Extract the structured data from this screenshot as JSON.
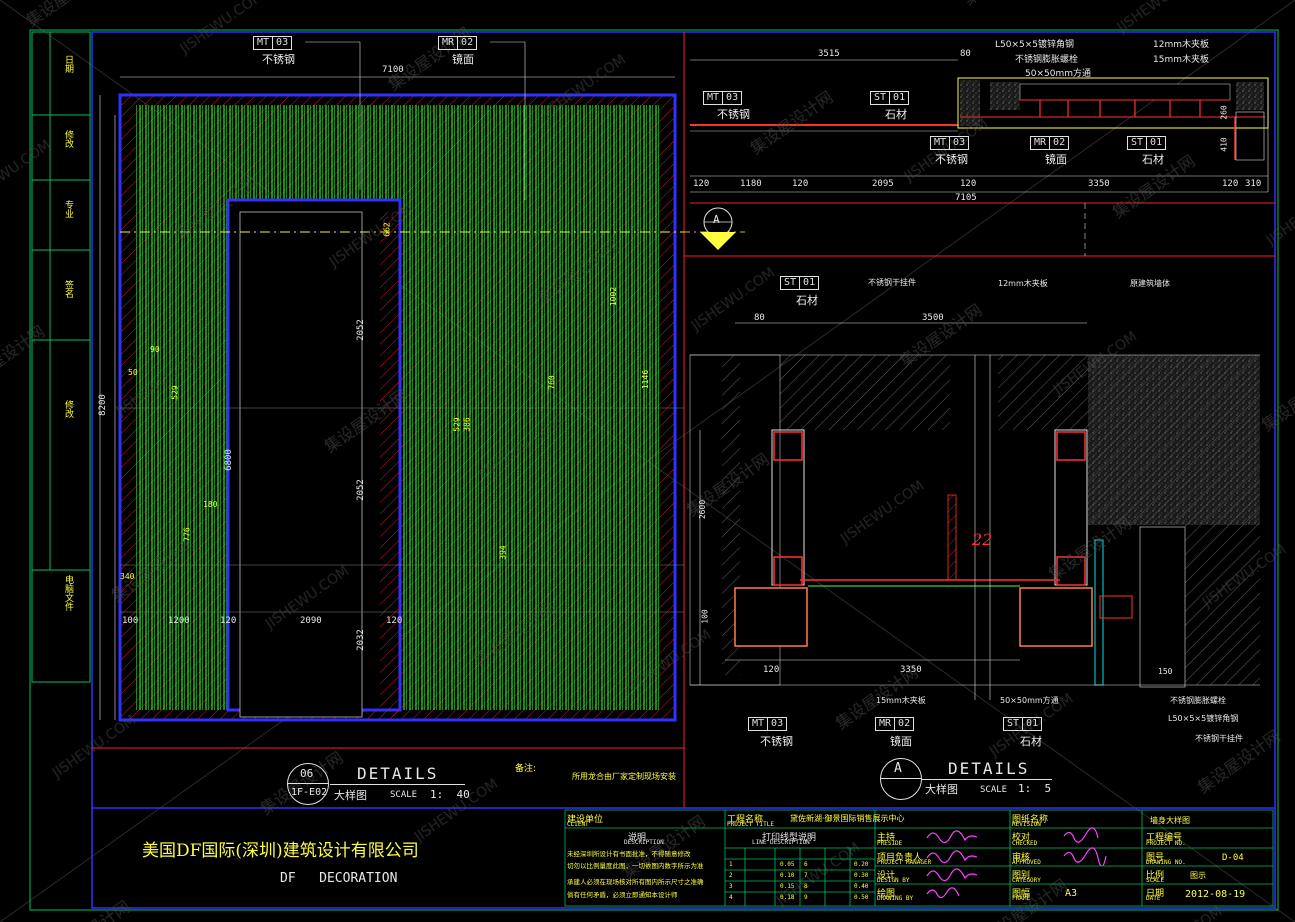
{
  "watermark": {
    "cn": "集设屋设计网",
    "en": "JISHEWU.COM"
  },
  "left_sidebar": [
    "日期",
    "修改",
    "专业",
    "签名",
    "修改",
    "电脑文件"
  ],
  "elevation": {
    "tags": [
      {
        "code": "MT",
        "num": "03",
        "name": "不锈钢"
      },
      {
        "code": "MR",
        "num": "02",
        "name": "镜面"
      }
    ],
    "dims": {
      "top_total": "7100",
      "left_total": "8200",
      "left_inner": "6800",
      "bottom": [
        "100",
        "1200",
        "120",
        "2090",
        "120"
      ],
      "center_stack": [
        "2052",
        "2052",
        "2032"
      ],
      "misc": [
        "662",
        "529",
        "529",
        "776",
        "180",
        "340",
        "386",
        "394",
        "760",
        "1002",
        "1146",
        "50",
        "90"
      ]
    },
    "title_num": "06",
    "title_ref": "1F-E02",
    "title_cn": "大样图",
    "title_en": "DETAILS",
    "scale_label": "SCALE",
    "scale_value": "1:  40"
  },
  "plan": {
    "tags": [
      {
        "code": "MT",
        "num": "03",
        "name": "不锈钢"
      },
      {
        "code": "ST",
        "num": "01",
        "name": "石材"
      },
      {
        "code": "MT",
        "num": "03",
        "name": "不锈钢"
      },
      {
        "code": "MR",
        "num": "02",
        "name": "镜面"
      },
      {
        "code": "ST",
        "num": "01",
        "name": "石材"
      }
    ],
    "notes": [
      "L50×5×5镀锌角钢",
      "不锈钢膨胀螺栓",
      "50×50mm方通",
      "12mm木夹板",
      "15mm木夹板"
    ],
    "dims_top": [
      "3515",
      "80"
    ],
    "dims_bottom": [
      "120",
      "1180",
      "120",
      "2095",
      "120",
      "3350",
      "120",
      "310"
    ],
    "dims_total": "7105",
    "dims_right": [
      "260",
      "410"
    ],
    "section_marker": "A"
  },
  "section": {
    "tags": [
      {
        "code": "ST",
        "num": "01",
        "name": "石材"
      },
      {
        "code": "MT",
        "num": "03",
        "name": "不锈钢"
      },
      {
        "code": "MR",
        "num": "02",
        "name": "镜面"
      },
      {
        "code": "ST",
        "num": "01",
        "name": "石材"
      }
    ],
    "notes": [
      "不锈钢干挂件",
      "12mm木夹板",
      "原建筑墙体",
      "15mm木夹板",
      "50×50mm方通",
      "不锈钢膨胀螺栓",
      "L50×5×5镀锌角钢",
      "不锈钢干挂件"
    ],
    "dims": [
      "80",
      "3500",
      "2600",
      "100",
      "120",
      "3350",
      "150"
    ],
    "title_num": "A",
    "title_cn": "大样图",
    "title_en": "DETAILS",
    "scale_label": "SCALE",
    "scale_value": "1:  5"
  },
  "remark": {
    "label": "备注:",
    "text": "所用龙合由厂家定制现场安装"
  },
  "company": {
    "cn": "美国DF国际(深圳)建筑设计有限公司",
    "en": "DF   DECORATION"
  },
  "title_block": {
    "client_cn": "建设单位",
    "client_en": "CLIENT",
    "desc_cn": "说明",
    "desc_en": "DESCRIPTION",
    "desc_lines": [
      "未经深圳所设计有书面批准，不得随意修改",
      "切勿以比例量度此图，一切依图内数字所示为准",
      "承建人必须在现场核对所有图内所示尺寸之准确",
      "倘有任何矛盾，必须立即通知本设计师"
    ],
    "project_cn": "工程名称",
    "project_en": "PROJECT TITLE",
    "project_name": "黛佐新湖·御景国际销售展示中心",
    "lineweight_cn": "打印线型说明",
    "lineweight_en": "LINE DESCRIPTION",
    "lw_rows": [
      [
        "1",
        "0.05",
        "6",
        "0.20"
      ],
      [
        "2",
        "0.10",
        "7",
        "0.30"
      ],
      [
        "3",
        "0.15",
        "8",
        "0.40"
      ],
      [
        "4",
        "0.18",
        "9",
        "0.50"
      ]
    ],
    "roles": [
      {
        "cn": "主持",
        "en": "PRESIDE"
      },
      {
        "cn": "项目负责人",
        "en": "PROJECT MANAGER"
      },
      {
        "cn": "设计",
        "en": "DESIGN BY"
      },
      {
        "cn": "绘图",
        "en": "DRAWING BY"
      }
    ],
    "drawing_name_cn": "图纸名称",
    "drawing_name_en": "REVISION",
    "drawing_name": "墙身大样图",
    "checked_cn": "校对",
    "checked_en": "CHECKED",
    "approved_cn": "审核",
    "approved_en": "APPROVED",
    "category_cn": "图别",
    "category_en": "CATEGORY",
    "frame_cn": "图幅",
    "frame_en": "FRAME",
    "frame_value": "A3",
    "projno_cn": "工程编号",
    "projno_en": "PROJECT NO.",
    "drawno_cn": "图号",
    "drawno_en": "DRAWING NO.",
    "drawno_value": "D-04",
    "scale_cn": "比例",
    "scale_en": "SCALE",
    "scale_value": "图示",
    "date_cn": "日期",
    "date_en": "DATE",
    "date_value": "2012-08-19"
  }
}
